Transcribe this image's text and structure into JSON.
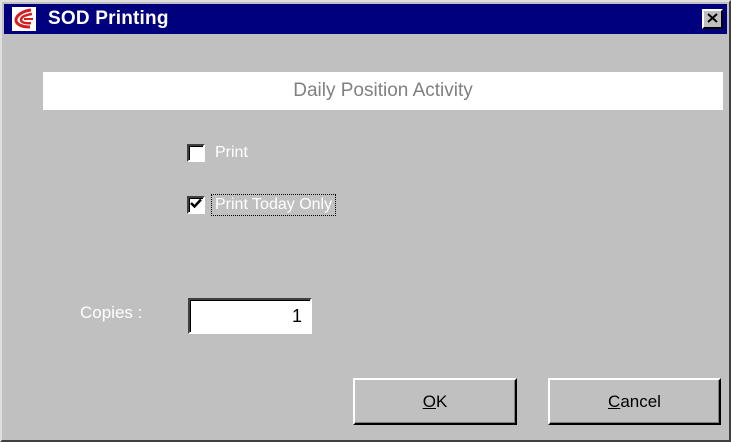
{
  "window": {
    "title": "SOD Printing",
    "icon": "app-logo-icon",
    "close_icon": "close-icon"
  },
  "header": {
    "title": "Daily Position Activity"
  },
  "options": {
    "print": {
      "label": "Print",
      "checked": false
    },
    "print_today_only": {
      "label": "Print Today Only",
      "checked": true
    }
  },
  "copies": {
    "label": "Copies :",
    "value": "1"
  },
  "buttons": {
    "ok": {
      "mnemonic": "O",
      "rest": "K"
    },
    "cancel": {
      "mnemonic": "C",
      "rest": "ancel"
    }
  },
  "colors": {
    "titlebar": "#00007f",
    "dialog_bg": "#c0c0c0",
    "logo_red": "#d42020"
  }
}
